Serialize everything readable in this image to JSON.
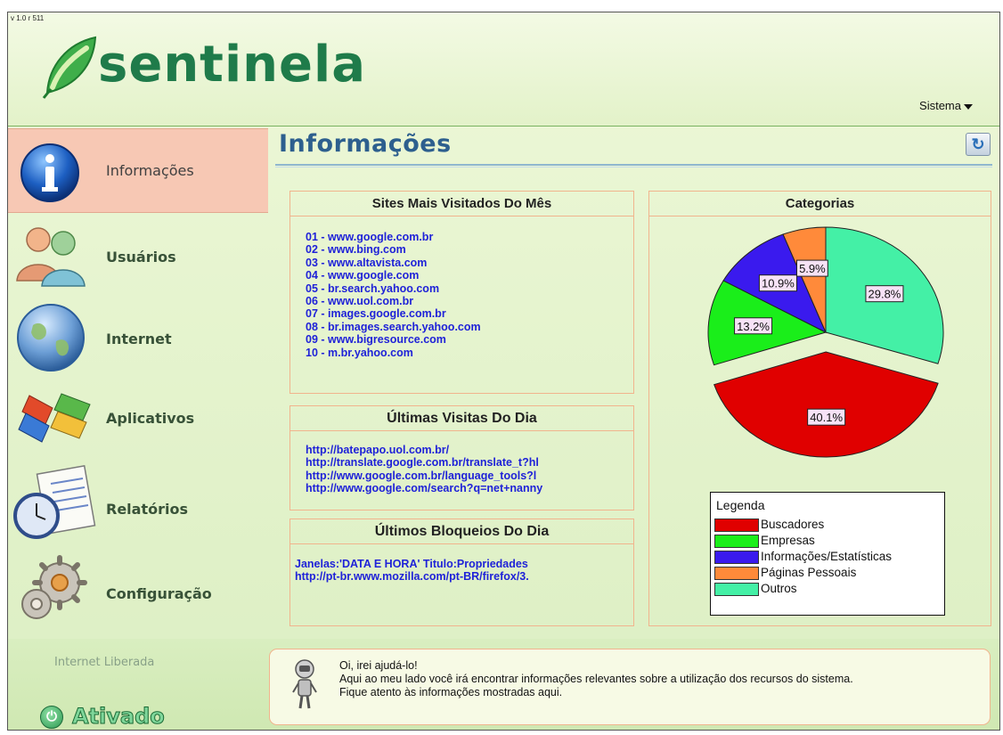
{
  "app": {
    "version": "v 1.0 r 511",
    "logo_text": "sentinela",
    "system_menu": "Sistema"
  },
  "sidebar": {
    "items": [
      {
        "label": "Informações",
        "icon": "info-icon",
        "active": true
      },
      {
        "label": "Usuários",
        "icon": "users-icon",
        "active": false
      },
      {
        "label": "Internet",
        "icon": "globe-icon",
        "active": false
      },
      {
        "label": "Aplicativos",
        "icon": "windows-logo-icon",
        "active": false
      },
      {
        "label": "Relatórios",
        "icon": "reports-clock-icon",
        "active": false
      },
      {
        "label": "Configuração",
        "icon": "gears-icon",
        "active": false
      }
    ],
    "status_text": "Internet Liberada",
    "activation_label": "Ativado"
  },
  "main": {
    "title": "Informações",
    "top_sites": {
      "title": "Sites Mais Visitados Do Mês",
      "items": [
        "01 - www.google.com.br",
        "02 - www.bing.com",
        "03 - www.altavista.com",
        "04 - www.google.com",
        "05 - br.search.yahoo.com",
        "06 - www.uol.com.br",
        "07 - images.google.com.br",
        "08 - br.images.search.yahoo.com",
        "09 - www.bigresource.com",
        "10 - m.br.yahoo.com"
      ]
    },
    "last_visits": {
      "title": "Últimas Visitas Do Dia",
      "items": [
        "http://batepapo.uol.com.br/",
        "http://translate.google.com.br/translate_t?hl",
        "http://www.google.com.br/language_tools?l",
        "http://www.google.com/search?q=net+nanny"
      ]
    },
    "last_blocks": {
      "title": "Últimos Bloqueios Do Dia",
      "items": [
        "Janelas:'DATA E HORA' Titulo:Propriedades",
        "http://pt-br.www.mozilla.com/pt-BR/firefox/3."
      ]
    },
    "categories": {
      "title": "Categorias",
      "legend_title": "Legenda"
    }
  },
  "chart_data": {
    "type": "pie",
    "title": "Categorias",
    "legend_title": "Legenda",
    "legend_placement": "bottom",
    "slices": [
      {
        "label": "Buscadores",
        "value": 40.1,
        "display": "40.1%",
        "color": "#e00000",
        "exploded": true
      },
      {
        "label": "Empresas",
        "value": 13.2,
        "display": "13.2%",
        "color": "#1aee1a",
        "exploded": false
      },
      {
        "label": "Informações/Estatísticas",
        "value": 10.9,
        "display": "10.9%",
        "color": "#3a1aee",
        "exploded": false
      },
      {
        "label": "Páginas Pessoais",
        "value": 5.9,
        "display": "5.9%",
        "color": "#ff8a3a",
        "exploded": false
      },
      {
        "label": "Outros",
        "value": 29.8,
        "display": "29.8%",
        "color": "#44f0a6",
        "exploded": false
      }
    ]
  },
  "help": {
    "lines": [
      "Oi, irei ajudá-lo!",
      "Aqui ao meu lado você irá encontrar informações relevantes sobre a utilização dos recursos do sistema.",
      "Fique atento às informações mostradas aqui."
    ]
  }
}
